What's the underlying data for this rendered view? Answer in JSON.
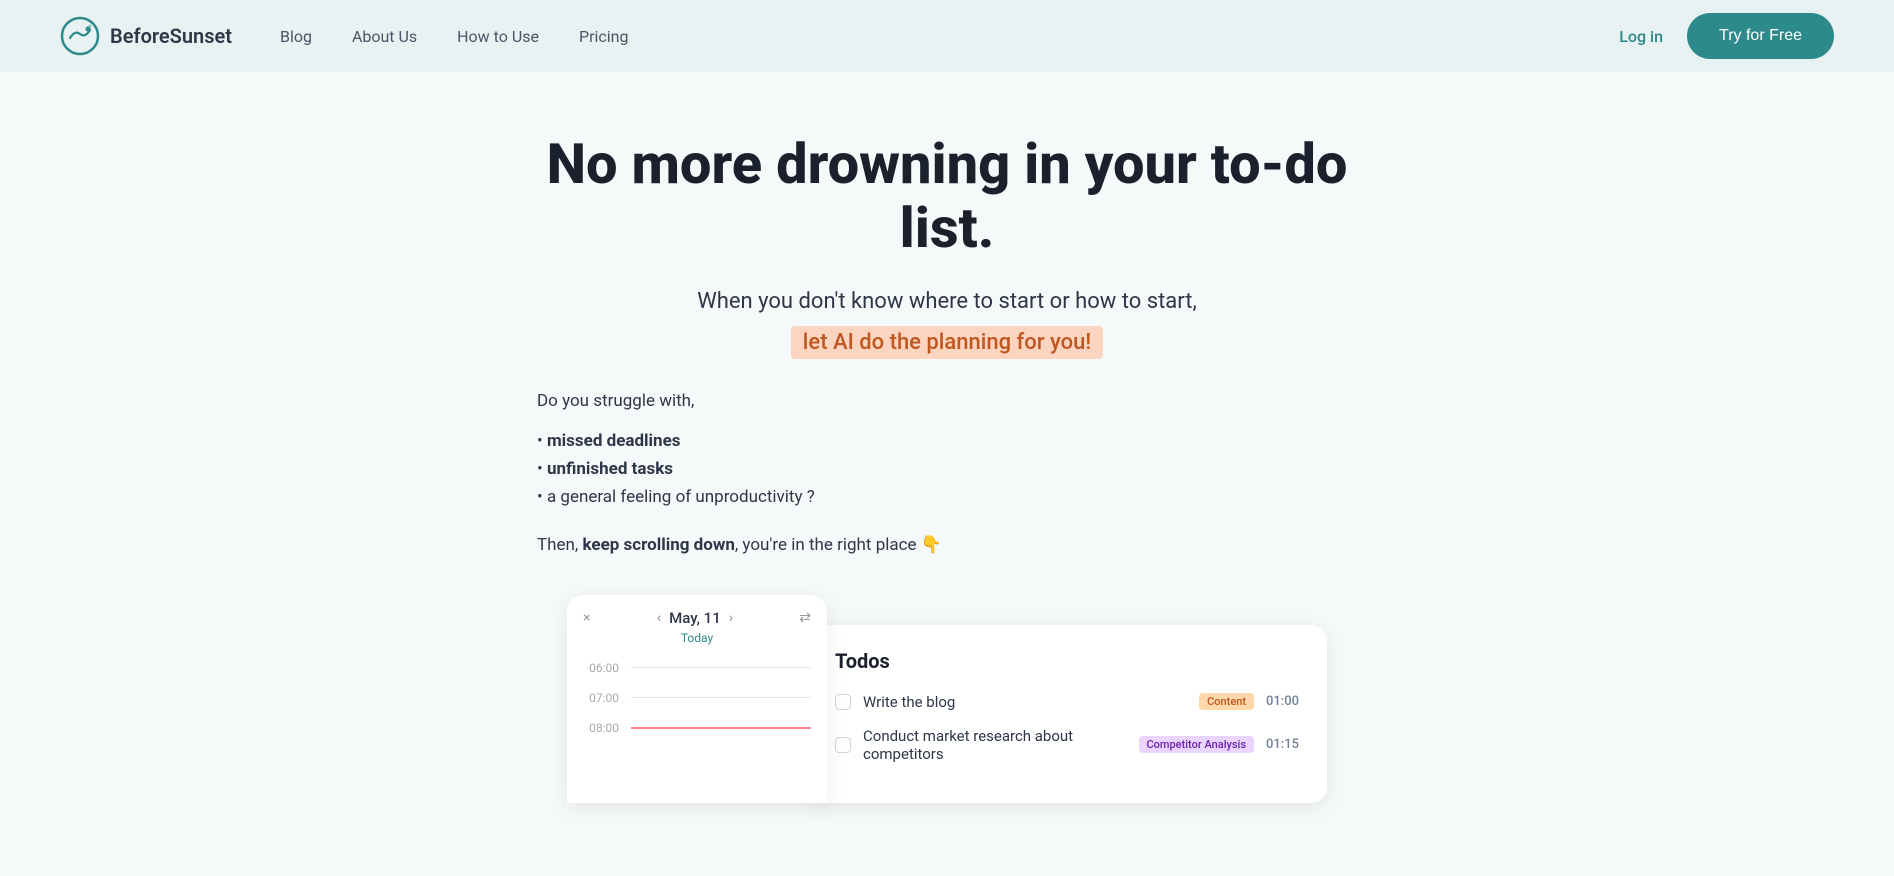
{
  "nav": {
    "logo_text": "BeforeSunset",
    "links": [
      {
        "label": "Blog",
        "href": "#"
      },
      {
        "label": "About Us",
        "href": "#"
      },
      {
        "label": "How to Use",
        "href": "#"
      },
      {
        "label": "Pricing",
        "href": "#"
      }
    ],
    "login_label": "Log in",
    "try_label": "Try for Free"
  },
  "hero": {
    "title": "No more drowning in your to-do list.",
    "subtitle": "When you don't know where to start or how to start,",
    "highlight": "let AI do the planning for you!",
    "struggle_intro": "Do you struggle with,",
    "struggle_items": [
      "missed deadlines",
      "unfinished tasks",
      "a general feeling of unproductivity ?"
    ],
    "cta_prefix": "Then, ",
    "cta_bold": "keep scrolling down",
    "cta_suffix": ", you're in the right place 👇"
  },
  "calendar": {
    "close_icon": "×",
    "prev_icon": "‹",
    "next_icon": "›",
    "date": "May, 11",
    "today_label": "Today",
    "settings_icon": "⇄",
    "times": [
      "06:00",
      "07:00",
      "08:00"
    ]
  },
  "todos": {
    "title": "Todos",
    "items": [
      {
        "label": "Write the blog",
        "tag": "Content",
        "tag_class": "tag-content",
        "time": "01:00"
      },
      {
        "label": "Conduct market research about competitors",
        "tag": "Competitor Analysis",
        "tag_class": "tag-competitor",
        "time": "01:15"
      }
    ]
  }
}
